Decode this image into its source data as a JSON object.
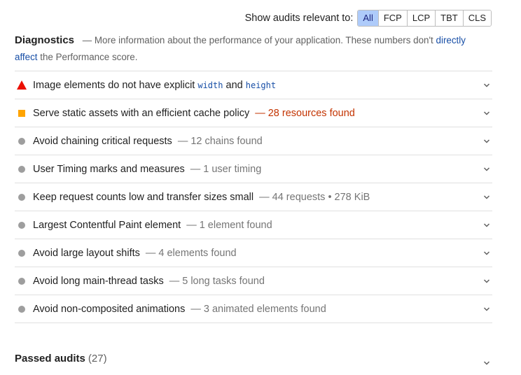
{
  "filter": {
    "label": "Show audits relevant to:",
    "options": [
      "All",
      "FCP",
      "LCP",
      "TBT",
      "CLS"
    ],
    "selected": "All"
  },
  "diagnostics": {
    "title": "Diagnostics",
    "desc_prefix": "— More information about the performance of your application. These numbers don't",
    "link_text": "directly affect",
    "desc_suffix": "the Performance score."
  },
  "audits": [
    {
      "status": "fail",
      "icon": "warning-triangle-icon",
      "title_parts": [
        "Image elements do not have explicit",
        "width",
        "and",
        "height"
      ],
      "display": ""
    },
    {
      "status": "average",
      "icon": "orange-square-icon",
      "title": "Serve static assets with an efficient cache policy",
      "display": "28 resources found"
    },
    {
      "status": "info",
      "icon": "gray-circle-icon",
      "title": "Avoid chaining critical requests",
      "display": "12 chains found"
    },
    {
      "status": "info",
      "icon": "gray-circle-icon",
      "title": "User Timing marks and measures",
      "display": "1 user timing"
    },
    {
      "status": "info",
      "icon": "gray-circle-icon",
      "title": "Keep request counts low and transfer sizes small",
      "display": "44 requests • 278 KiB"
    },
    {
      "status": "info",
      "icon": "gray-circle-icon",
      "title": "Largest Contentful Paint element",
      "display": "1 element found"
    },
    {
      "status": "info",
      "icon": "gray-circle-icon",
      "title": "Avoid large layout shifts",
      "display": "4 elements found"
    },
    {
      "status": "info",
      "icon": "gray-circle-icon",
      "title": "Avoid long main-thread tasks",
      "display": "5 long tasks found"
    },
    {
      "status": "info",
      "icon": "gray-circle-icon",
      "title": "Avoid non-composited animations",
      "display": "3 animated elements found"
    }
  ],
  "passed": {
    "title": "Passed audits",
    "count": "(27)"
  },
  "separator": "—",
  "colors": {
    "fail": "#eb0f00",
    "average": "#ffa400",
    "info": "#9e9e9e",
    "warn_text": "#c33300",
    "link": "#174ea6",
    "selected_filter": "#aecbfa"
  }
}
